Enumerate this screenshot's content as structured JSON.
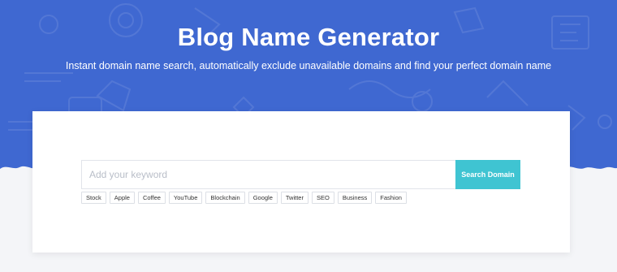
{
  "header": {
    "title": "Blog Name Generator",
    "subtitle": "Instant domain name search, automatically exclude unavailable domains and find your perfect domain name"
  },
  "search": {
    "placeholder": "Add your keyword",
    "button_label": "Search Domain"
  },
  "tags": [
    "Stock",
    "Apple",
    "Coffee",
    "YouTube",
    "Blockchain",
    "Google",
    "Twitter",
    "SEO",
    "Business",
    "Fashion"
  ],
  "colors": {
    "hero_background": "#3f68d1",
    "button_background": "#3fc4d2",
    "page_background": "#f4f5f8"
  }
}
